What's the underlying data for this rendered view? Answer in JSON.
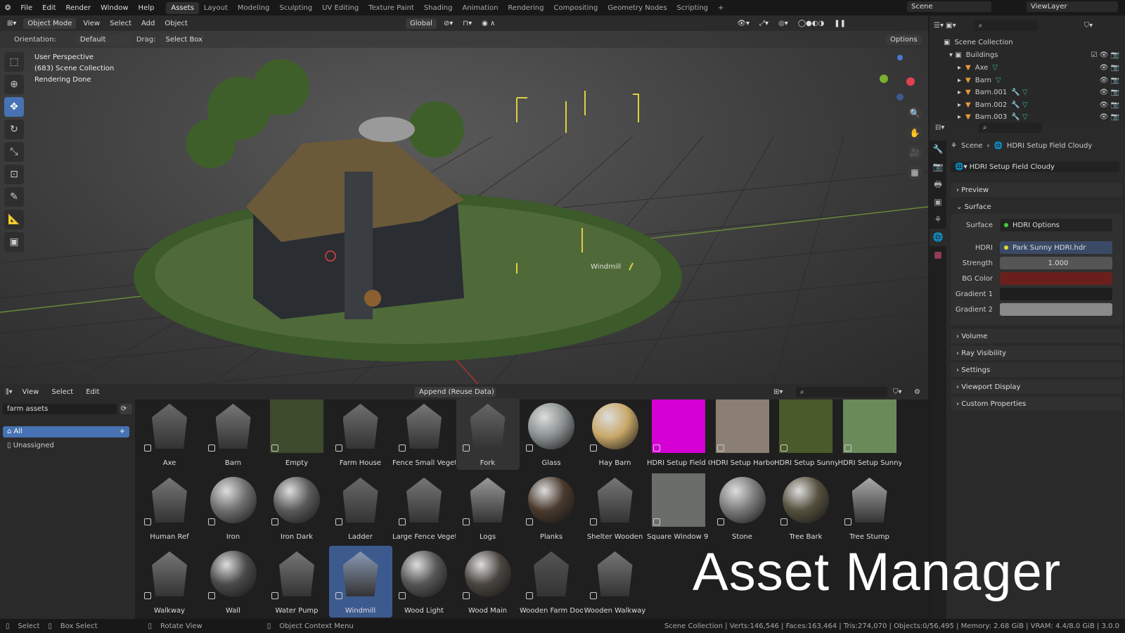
{
  "topbar": {
    "menus": [
      "File",
      "Edit",
      "Render",
      "Window",
      "Help"
    ],
    "workspaces": [
      "Assets",
      "Layout",
      "Modeling",
      "Sculpting",
      "UV Editing",
      "Texture Paint",
      "Shading",
      "Animation",
      "Rendering",
      "Compositing",
      "Geometry Nodes",
      "Scripting"
    ],
    "active_workspace": "Assets",
    "add": "+",
    "scene": "Scene",
    "view_layer": "ViewLayer"
  },
  "viewport": {
    "mode": "Object Mode",
    "menus": [
      "View",
      "Select",
      "Add",
      "Object"
    ],
    "transform": "Global",
    "orientation_label": "Orientation:",
    "orientation": "Default",
    "drag_label": "Drag:",
    "drag": "Select Box",
    "options": "Options",
    "info": [
      "User Perspective",
      "(683) Scene Collection",
      "Rendering Done"
    ],
    "object_label": "Windmill"
  },
  "asset_browser": {
    "menus": [
      "View",
      "Select",
      "Edit"
    ],
    "import_mode": "Append (Reuse Data)",
    "library": "farm assets",
    "catalogs": [
      "All",
      "Unassigned"
    ],
    "assets": [
      {
        "name": "Axe",
        "thumb": "object",
        "color": "#6a6a6a"
      },
      {
        "name": "Barn",
        "thumb": "object",
        "color": "#777"
      },
      {
        "name": "Empty",
        "thumb": "image",
        "color": "#3d4a2c"
      },
      {
        "name": "Farm House",
        "thumb": "object",
        "color": "#6f6f6f"
      },
      {
        "name": "Fence Small Vegeta...",
        "thumb": "object",
        "color": "#777"
      },
      {
        "name": "Fork",
        "thumb": "object",
        "color": "#666"
      },
      {
        "name": "Glass",
        "thumb": "sphere",
        "color": "#8a9090"
      },
      {
        "name": "Hay Barn",
        "thumb": "sphere",
        "color": "#c9a86a"
      },
      {
        "name": "HDRI Setup Field C...",
        "thumb": "square",
        "color": "#d400d4"
      },
      {
        "name": "HDRI Setup Harbor",
        "thumb": "square",
        "color": "#8a7f72"
      },
      {
        "name": "HDRI Setup Sunny ...",
        "thumb": "square",
        "color": "#4a5a2a"
      },
      {
        "name": "HDRI Setup Sunny ...",
        "thumb": "square",
        "color": "#6a8a5a"
      },
      {
        "name": "Human Ref",
        "thumb": "object",
        "color": "#777"
      },
      {
        "name": "Iron",
        "thumb": "sphere",
        "color": "#6e6e6e"
      },
      {
        "name": "Iron Dark",
        "thumb": "sphere",
        "color": "#5a5a5a"
      },
      {
        "name": "Ladder",
        "thumb": "object",
        "color": "#6a6a6a"
      },
      {
        "name": "Large Fence Vegeta...",
        "thumb": "object",
        "color": "#777"
      },
      {
        "name": "Logs",
        "thumb": "object",
        "color": "#999"
      },
      {
        "name": "Planks",
        "thumb": "sphere",
        "color": "#4a3a2e"
      },
      {
        "name": "Shelter Wooden",
        "thumb": "object",
        "color": "#777"
      },
      {
        "name": "Square Window 9 ...",
        "thumb": "square",
        "color": "#6a6e6a"
      },
      {
        "name": "Stone",
        "thumb": "sphere",
        "color": "#7a7a7a"
      },
      {
        "name": "Tree Bark",
        "thumb": "sphere",
        "color": "#55503e"
      },
      {
        "name": "Tree Stump",
        "thumb": "object",
        "color": "#aaa"
      },
      {
        "name": "Walkway",
        "thumb": "object",
        "color": "#777"
      },
      {
        "name": "Wall",
        "thumb": "sphere",
        "color": "#4a4a4a"
      },
      {
        "name": "Water Pump",
        "thumb": "object",
        "color": "#777"
      },
      {
        "name": "Windmill",
        "thumb": "object",
        "color": "#8a9ab5",
        "selected": true
      },
      {
        "name": "Wood Light",
        "thumb": "sphere",
        "color": "#555"
      },
      {
        "name": "Wood Main",
        "thumb": "sphere",
        "color": "#4a4540"
      },
      {
        "name": "Wooden Farm Door",
        "thumb": "object",
        "color": "#555"
      },
      {
        "name": "Wooden Walkway",
        "thumb": "object",
        "color": "#777"
      }
    ]
  },
  "outliner": {
    "root": "Scene Collection",
    "collection": "Buildings",
    "objects": [
      "Axe",
      "Barn",
      "Barn.001",
      "Barn.002",
      "Barn.003"
    ]
  },
  "properties": {
    "breadcrumb_scene": "Scene",
    "breadcrumb_world": "HDRI Setup Field Cloudy",
    "world_name": "HDRI Setup Field Cloudy",
    "panels_top": [
      "Preview",
      "Surface"
    ],
    "surface": {
      "surface_label": "Surface",
      "surface_value": "HDRI Options",
      "hdri_label": "HDRI",
      "hdri_value": "Park Sunny HDRI.hdr",
      "strength_label": "Strength",
      "strength_value": "1.000",
      "bg_label": "BG Color",
      "bg_color": "#6b1f1c",
      "g1_label": "Gradient 1",
      "g1_color": "#1e1e1e",
      "g2_label": "Gradient 2",
      "g2_color": "#8a8a8a"
    },
    "panels_bottom": [
      "Volume",
      "Ray Visibility",
      "Settings",
      "Viewport Display",
      "Custom Properties"
    ]
  },
  "status": {
    "items": [
      "Select",
      "Box Select",
      "Rotate View",
      "Object Context Menu"
    ],
    "stats": "Scene Collection | Verts:146,546 | Faces:163,464 | Tris:274,070 | Objects:0/56,495 | Memory: 2.68 GiB | VRAM: 4.4/8.0 GiB | 3.0.0"
  },
  "overlay_title": "Asset Manager"
}
